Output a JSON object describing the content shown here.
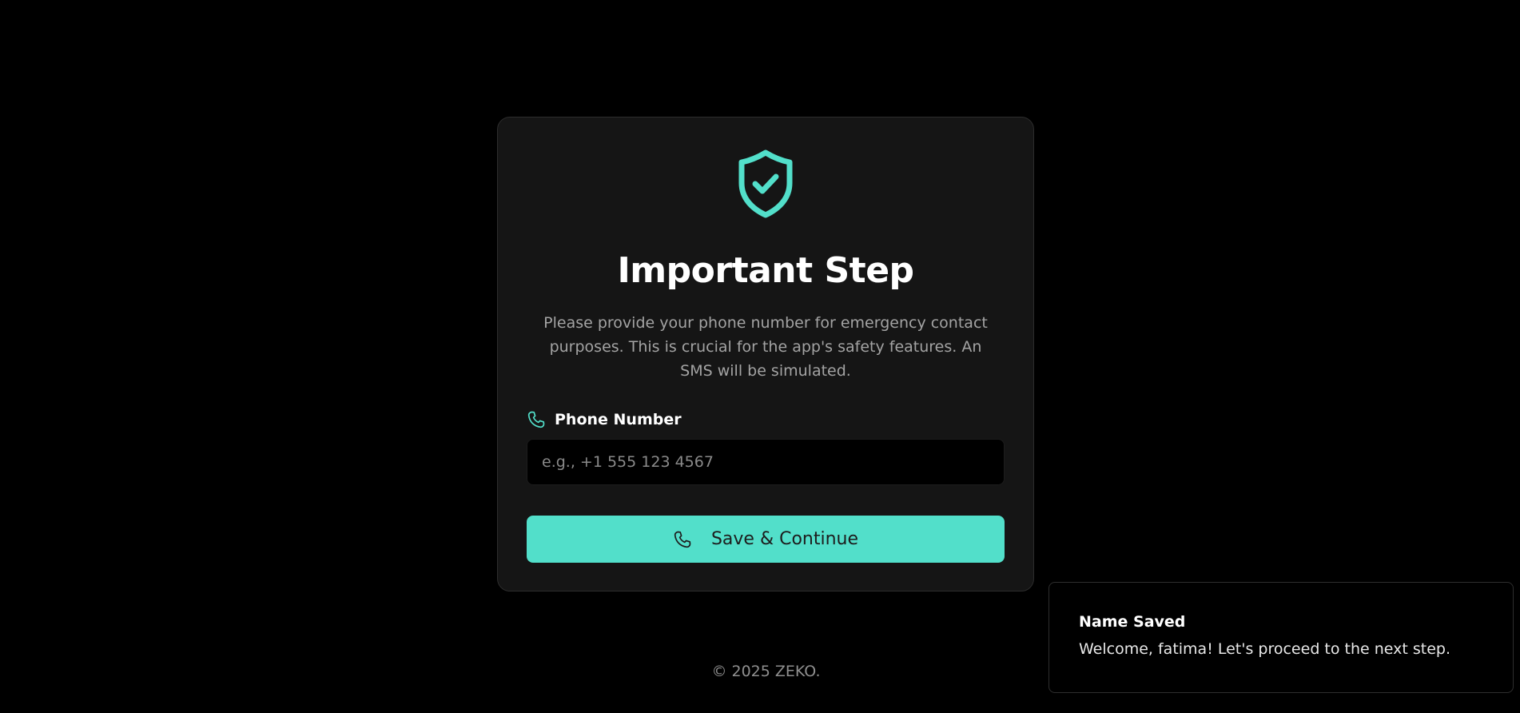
{
  "card": {
    "title": "Important Step",
    "description": "Please provide your phone number for emergency contact purposes. This is crucial for the app's safety features. An SMS will be simulated.",
    "phone_label": "Phone Number",
    "phone_value": "",
    "phone_placeholder": "e.g., +1 555 123 4567",
    "save_label": "Save & Continue"
  },
  "footer": {
    "text": "© 2025 ZEKO."
  },
  "toast": {
    "title": "Name Saved",
    "message": "Welcome, fatima! Let's proceed to the next step."
  },
  "icons": {
    "header": "shield-check-icon",
    "label": "phone-icon",
    "button": "phone-icon"
  },
  "colors": {
    "accent": "#52dfca",
    "background": "#000000",
    "card": "#151515"
  }
}
